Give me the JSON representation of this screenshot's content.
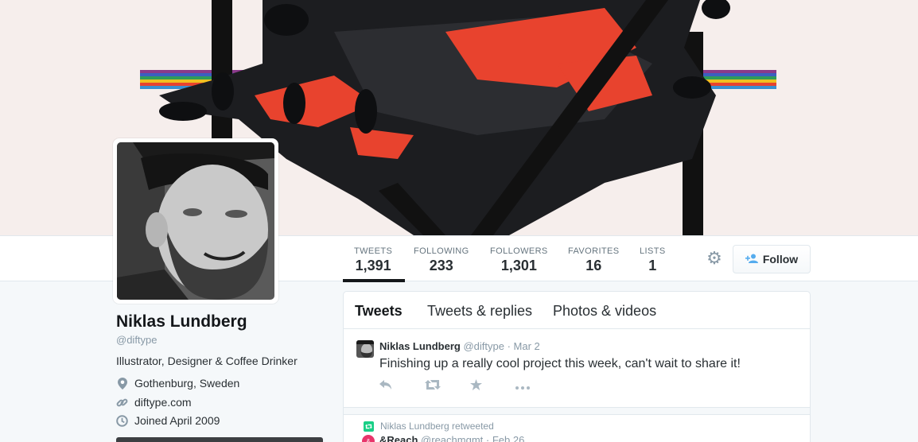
{
  "profile": {
    "name": "Niklas Lundberg",
    "handle": "@diftype",
    "bio": "Illustrator, Designer & Coffee Drinker",
    "location": "Gothenburg, Sweden",
    "website": "diftype.com",
    "joined": "Joined April 2009"
  },
  "stats": [
    {
      "label": "TWEETS",
      "value": "1,391"
    },
    {
      "label": "FOLLOWING",
      "value": "233"
    },
    {
      "label": "FOLLOWERS",
      "value": "1,301"
    },
    {
      "label": "FAVORITES",
      "value": "16"
    },
    {
      "label": "LISTS",
      "value": "1"
    }
  ],
  "actions": {
    "follow_label": "Follow",
    "gear_icon": "gear-icon",
    "follow_icon": "add-user-icon"
  },
  "tabs": [
    {
      "label": "Tweets",
      "active": true
    },
    {
      "label": "Tweets & replies",
      "active": false
    },
    {
      "label": "Photos & videos",
      "active": false
    }
  ],
  "tweets": [
    {
      "author": "Niklas Lundberg",
      "handle": "@diftype",
      "date": "· Mar 2",
      "text": "Finishing up a really cool project this week, can't wait to share it!",
      "icons": [
        "reply-icon",
        "retweet-icon",
        "favorite-icon",
        "more-icon"
      ]
    }
  ],
  "retweet": {
    "line": "Niklas Lundberg retweeted",
    "author": "&Reach",
    "handle": "@reachmgmt",
    "date": "· Feb 26"
  },
  "colors": {
    "accent": "#55acee",
    "text": "#292f33",
    "muted": "#8899a6",
    "banner_bg": "#f6eeec",
    "banner_red": "#e8432e",
    "retweet_green": "#19cf86"
  }
}
